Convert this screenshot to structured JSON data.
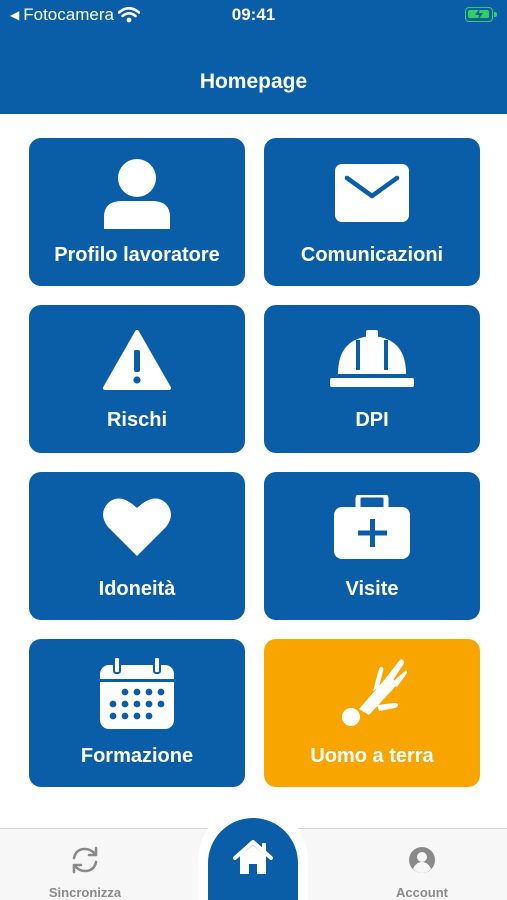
{
  "status_bar": {
    "back_app": "Fotocamera",
    "time": "09:41"
  },
  "header": {
    "title": "Homepage"
  },
  "tiles": [
    {
      "label": "Profilo lavoratore",
      "icon": "user-icon"
    },
    {
      "label": "Comunicazioni",
      "icon": "envelope-icon"
    },
    {
      "label": "Rischi",
      "icon": "warning-icon"
    },
    {
      "label": "DPI",
      "icon": "hard-hat-icon"
    },
    {
      "label": "Idoneità",
      "icon": "heart-icon"
    },
    {
      "label": "Visite",
      "icon": "medical-kit-icon"
    },
    {
      "label": "Formazione",
      "icon": "calendar-icon"
    },
    {
      "label": "Uomo a terra",
      "icon": "falling-person-icon"
    }
  ],
  "tab_bar": {
    "sync_label": "Sincronizza",
    "account_label": "Account"
  },
  "colors": {
    "primary": "#0a5ea8",
    "emergency": "#f8a500",
    "tab_inactive": "#8a8a8a",
    "battery": "#2fd15a"
  }
}
